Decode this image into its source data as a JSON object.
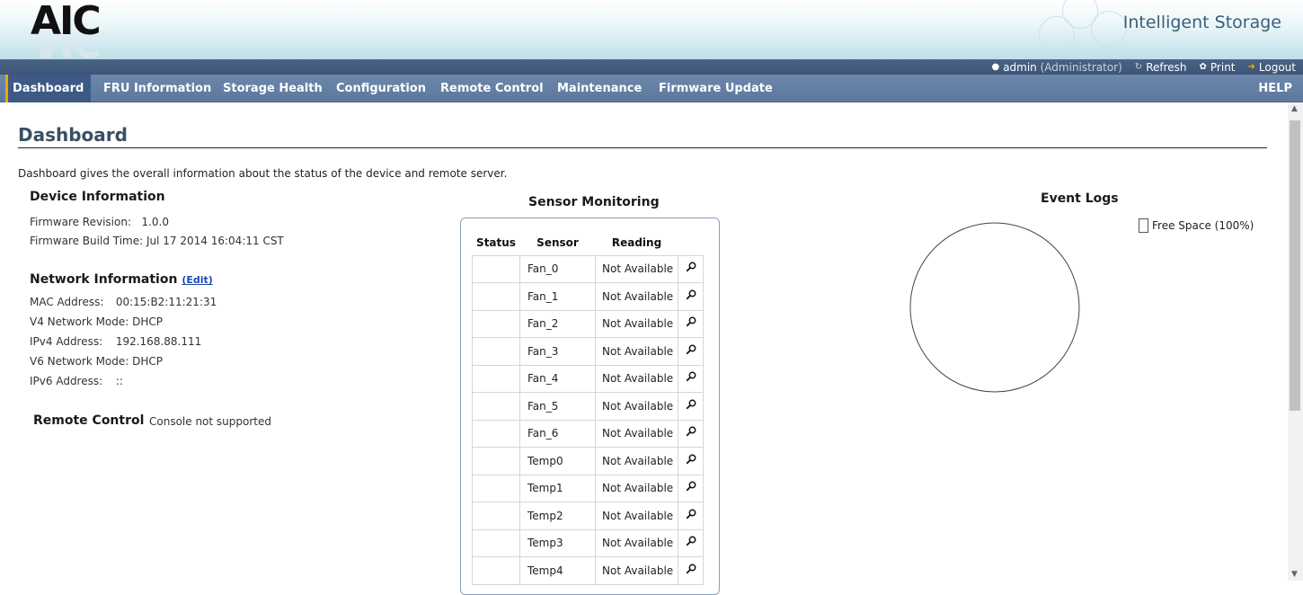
{
  "header": {
    "logo_text": "AIC",
    "brand": "Intelligent Storage"
  },
  "utility": {
    "user": "admin",
    "role": "(Administrator)",
    "refresh": "Refresh",
    "print": "Print",
    "logout": "Logout"
  },
  "nav": {
    "items": [
      "Dashboard",
      "FRU Information",
      "Storage Health",
      "Configuration",
      "Remote Control",
      "Maintenance",
      "Firmware Update"
    ],
    "active": "Dashboard",
    "help": "HELP"
  },
  "page": {
    "title": "Dashboard",
    "intro": "Dashboard gives the overall information about the status of the device and remote server."
  },
  "device": {
    "heading": "Device Information",
    "firmware_revision_label": "Firmware Revision:",
    "firmware_revision": "1.0.0",
    "build_time_label": "Firmware Build Time:",
    "build_time": "Jul 17 2014 16:04:11 CST"
  },
  "network": {
    "heading": "Network Information",
    "edit": "(Edit)",
    "mac_label": "MAC Address:",
    "mac": "00:15:B2:11:21:31",
    "v4mode_label": "V4 Network Mode:",
    "v4mode": "DHCP",
    "ipv4_label": "IPv4 Address:",
    "ipv4": "192.168.88.111",
    "v6mode_label": "V6 Network Mode:",
    "v6mode": "DHCP",
    "ipv6_label": "IPv6 Address:",
    "ipv6": "::"
  },
  "remote": {
    "heading": "Remote Control",
    "status": "Console not supported"
  },
  "sensors": {
    "heading": "Sensor Monitoring",
    "columns": [
      "Status",
      "Sensor",
      "Reading"
    ],
    "rows": [
      {
        "name": "Fan_0",
        "reading": "Not Available"
      },
      {
        "name": "Fan_1",
        "reading": "Not Available"
      },
      {
        "name": "Fan_2",
        "reading": "Not Available"
      },
      {
        "name": "Fan_3",
        "reading": "Not Available"
      },
      {
        "name": "Fan_4",
        "reading": "Not Available"
      },
      {
        "name": "Fan_5",
        "reading": "Not Available"
      },
      {
        "name": "Fan_6",
        "reading": "Not Available"
      },
      {
        "name": "Temp0",
        "reading": "Not Available"
      },
      {
        "name": "Temp1",
        "reading": "Not Available"
      },
      {
        "name": "Temp2",
        "reading": "Not Available"
      },
      {
        "name": "Temp3",
        "reading": "Not Available"
      },
      {
        "name": "Temp4",
        "reading": "Not Available"
      }
    ],
    "detail_icon": "magnifier-icon"
  },
  "event_logs": {
    "heading": "Event Logs",
    "legend": "Free Space (100%)"
  },
  "chart_data": {
    "type": "pie",
    "categories": [
      "Free Space"
    ],
    "values": [
      100
    ],
    "title": "Event Logs",
    "legend_placement": "top-right",
    "colors": [
      "#ffffff"
    ]
  },
  "colors": {
    "nav_bg": "#6c87ab",
    "nav_active": "#3c5a85",
    "util_bg": "#3d5577",
    "title_color": "#3a4f63"
  }
}
